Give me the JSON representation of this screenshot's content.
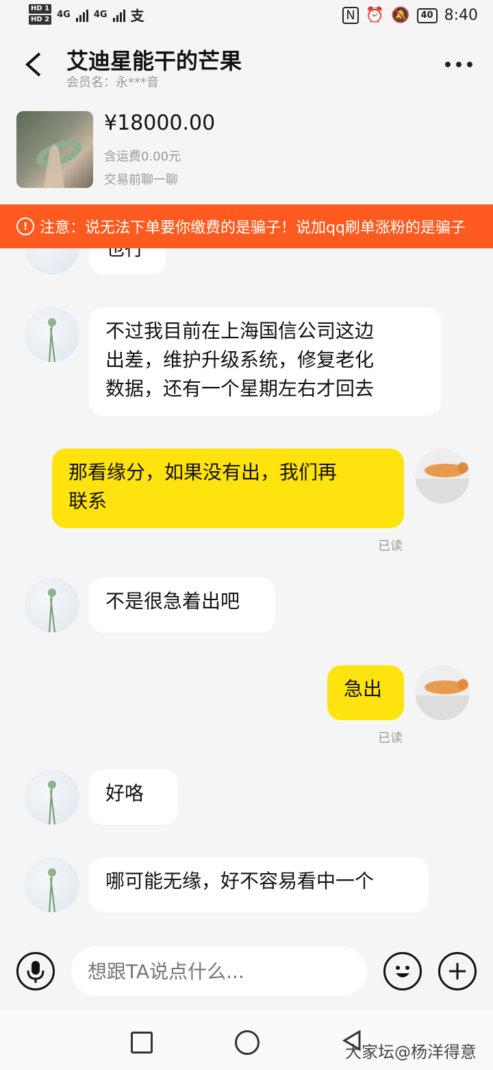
{
  "status_bar": {
    "sim1": "HD 1",
    "sim2": "HD 2",
    "net1": "4G",
    "net2": "4G",
    "battery": "40",
    "time": "8:40"
  },
  "header": {
    "title": "艾迪星能干的芒果",
    "member": "会员名：永***音"
  },
  "product": {
    "price": "¥18000.00",
    "shipping": "含运费0.00元",
    "hint": "交易前聊一聊"
  },
  "notice": {
    "text": "注意：说无法下单要你缴费的是骗子！说加qq刷单涨粉的是骗子"
  },
  "messages": [
    {
      "side": "in",
      "text": "也行"
    },
    {
      "side": "in",
      "text": "不过我目前在上海国信公司这边\n出差，维护升级系统，修复老化\n数据，还有一个星期左右才回去"
    },
    {
      "side": "out",
      "text": "那看缘分，如果没有出，我们再\n联系",
      "status": "已读"
    },
    {
      "side": "in",
      "text": "不是很急着出吧"
    },
    {
      "side": "out",
      "text": "急出",
      "status": "已读"
    },
    {
      "side": "in",
      "text": "好咯"
    },
    {
      "side": "in",
      "text": "哪可能无缘，好不容易看中一个"
    }
  ],
  "input": {
    "placeholder": "想跟TA说点什么..."
  },
  "watermark": "大家坛@杨洋得意"
}
